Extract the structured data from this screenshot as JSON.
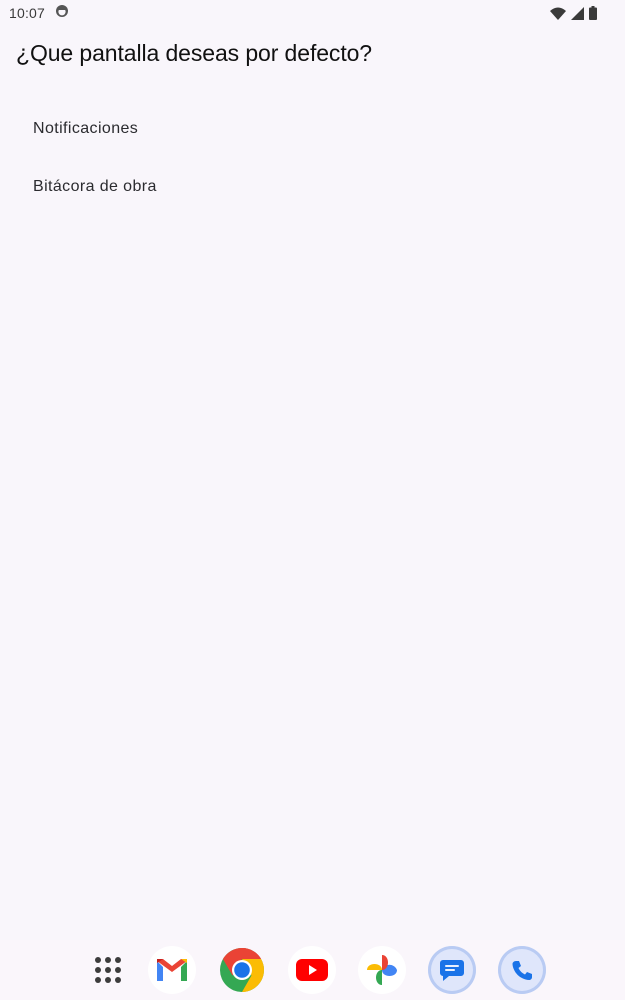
{
  "status_bar": {
    "time": "10:07",
    "icons": [
      "notification-app-icon",
      "wifi-icon",
      "cell-signal-icon",
      "battery-icon"
    ]
  },
  "page": {
    "title": "¿Que pantalla deseas por defecto?"
  },
  "options": [
    {
      "label": "Notificaciones"
    },
    {
      "label": "Bitácora de obra"
    }
  ],
  "dock": {
    "apps": [
      "app-drawer-icon",
      "gmail-icon",
      "chrome-icon",
      "youtube-icon",
      "photos-icon",
      "messages-icon",
      "phone-icon"
    ]
  },
  "colors": {
    "background": "#f9f6fb",
    "text": "#1c1b1f"
  }
}
